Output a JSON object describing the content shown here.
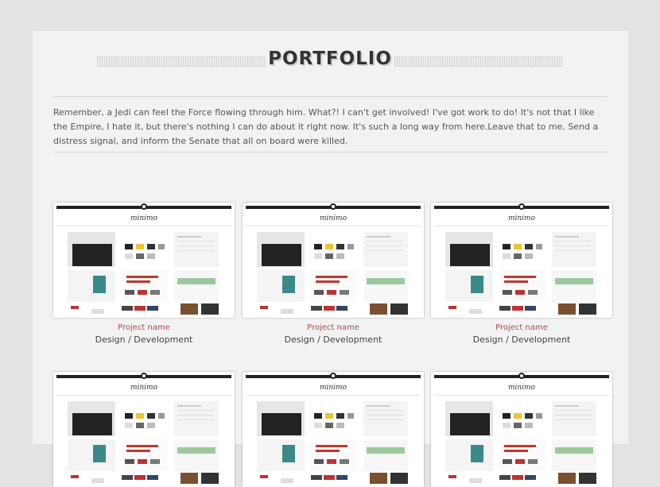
{
  "page": {
    "title": "PORTFOLIO",
    "intro": "Remember, a Jedi can feel the Force flowing through him. What?! I can't get involved! I've got work to do! It's not that I like the Empire, I hate it, but there's nothing I can do about it right now. It's such a long way from here.Leave that to me. Send a distress signal, and inform the Senate that all on board were killed."
  },
  "items": [
    {
      "name": "Project name",
      "category": "Design / Development",
      "thumb_logo": "minimo"
    },
    {
      "name": "Project name",
      "category": "Design / Development",
      "thumb_logo": "minimo"
    },
    {
      "name": "Project name",
      "category": "Design / Development",
      "thumb_logo": "minimo"
    },
    {
      "thumb_logo": "minimo"
    },
    {
      "thumb_logo": "minimo"
    },
    {
      "thumb_logo": "minimo"
    }
  ],
  "colors": {
    "background": "#e3e3e3",
    "panel": "#f2f2f2",
    "project_name": "#a9504a",
    "title": "#333333"
  }
}
